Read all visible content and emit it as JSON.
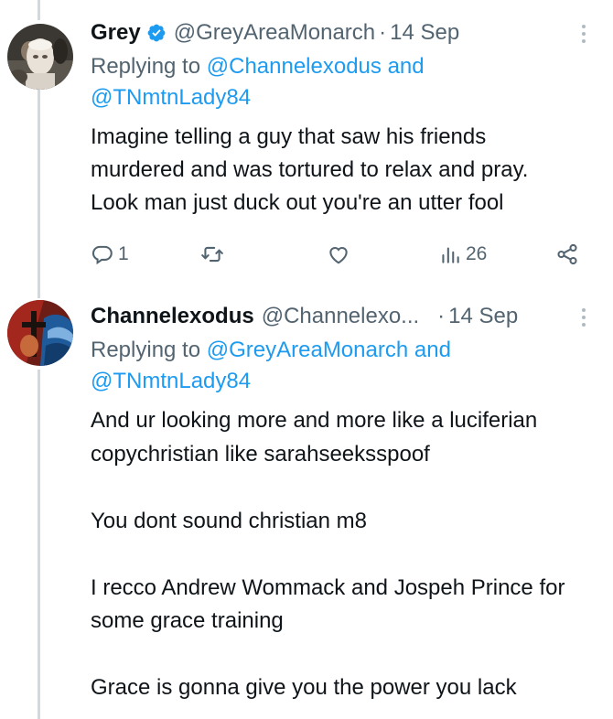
{
  "tweets": [
    {
      "display_name": "Grey",
      "verified": true,
      "handle": "@GreyAreaMonarch",
      "separator": "·",
      "time": "14 Sep",
      "reply_prefix": "Replying to",
      "reply_user1": "@Channelexodus",
      "reply_and": "and",
      "reply_user2": "@TNmtnLady84",
      "text": "Imagine telling a guy that saw his friends murdered and was tortured to relax and pray. Look man just duck out you're an utter fool",
      "actions": {
        "reply_count": "1",
        "retweet_count": "",
        "like_count": "",
        "views_count": "26"
      }
    },
    {
      "display_name": "Channelexodus",
      "handle": "@Channelexo...",
      "separator": "·",
      "time": "14 Sep",
      "reply_prefix": "Replying to",
      "reply_user1": "@GreyAreaMonarch",
      "reply_and": "and",
      "reply_user2": "@TNmtnLady84",
      "text": "And ur looking more and more like a luciferian copychristian like sarahseeksspoof\n\nYou dont sound christian m8\n\nI recco Andrew Wommack and Jospeh Prince for some grace training\n\nGrace is gonna give you the power you lack"
    }
  ],
  "icons": {
    "verified": "verified-badge-icon",
    "more": "more-dots-icon",
    "reply": "reply-icon",
    "retweet": "retweet-icon",
    "like": "heart-icon",
    "views": "views-icon",
    "share": "share-icon"
  },
  "colors": {
    "accent": "#1d9bf0",
    "secondary_text": "#536471",
    "primary_text": "#0f1419",
    "thread_line": "#cfd9de"
  }
}
